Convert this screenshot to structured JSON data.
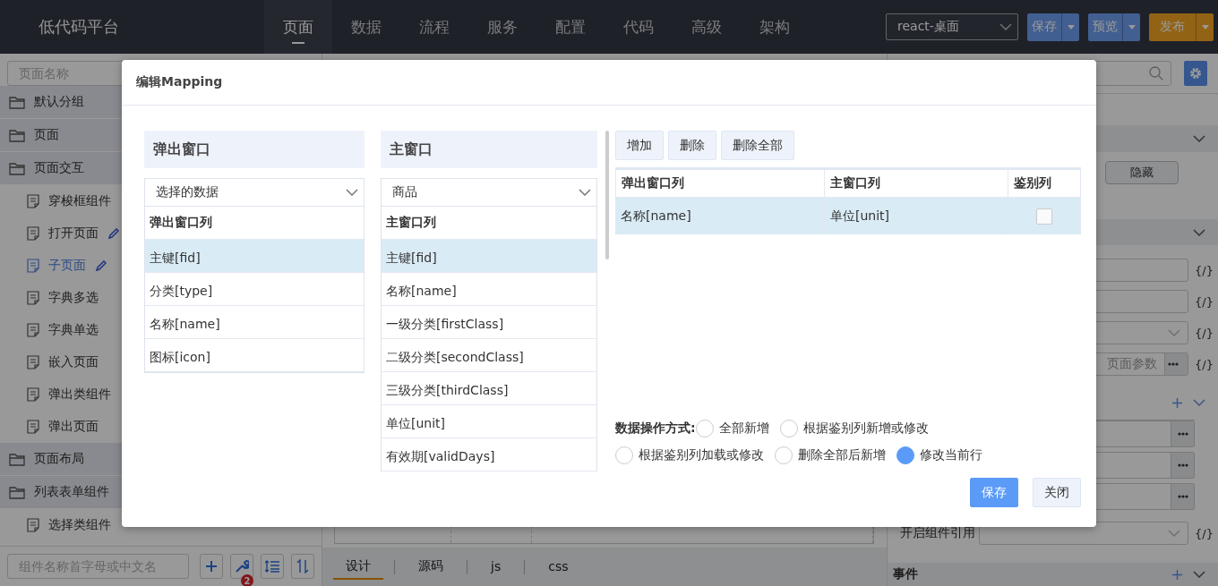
{
  "top_bar": {
    "logo": "低代码平台",
    "nav": [
      {
        "label": "页面",
        "selected": true
      },
      {
        "label": "数据",
        "selected": false
      },
      {
        "label": "流程",
        "selected": false
      },
      {
        "label": "服务",
        "selected": false
      },
      {
        "label": "配置",
        "selected": false
      },
      {
        "label": "代码",
        "selected": false
      },
      {
        "label": "高级",
        "selected": false
      },
      {
        "label": "架构",
        "selected": false
      }
    ],
    "project_select": {
      "value": "react-桌面"
    },
    "buttons": [
      {
        "label": "保存",
        "kind": "primary"
      },
      {
        "label": "预览",
        "kind": "primary"
      },
      {
        "label": "发布",
        "kind": "warning"
      }
    ]
  },
  "sidebar": {
    "search": {
      "placeholder": "页面名称"
    },
    "tree": [
      {
        "label": "默认分组",
        "kind": "folder"
      },
      {
        "label": "页面",
        "kind": "folder"
      },
      {
        "label": "页面交互",
        "kind": "folder",
        "children": [
          {
            "label": "穿梭框组件",
            "kind": "page",
            "selected": false,
            "editable": false
          },
          {
            "label": "打开页面",
            "kind": "page",
            "selected": false,
            "editable": true
          },
          {
            "label": "子页面",
            "kind": "page",
            "selected": true,
            "editable": true
          },
          {
            "label": "字典多选",
            "kind": "page",
            "selected": false,
            "editable": false
          },
          {
            "label": "字典单选",
            "kind": "page",
            "selected": false,
            "editable": false
          },
          {
            "label": "嵌入页面",
            "kind": "page",
            "selected": false,
            "editable": false
          },
          {
            "label": "弹出类组件",
            "kind": "page",
            "selected": false,
            "editable": false
          },
          {
            "label": "弹出页面",
            "kind": "page",
            "selected": false,
            "editable": false
          }
        ]
      },
      {
        "label": "页面布局",
        "kind": "folder"
      },
      {
        "label": "列表表单组件",
        "kind": "folder",
        "children": [
          {
            "label": "选择类组件",
            "kind": "page",
            "selected": false,
            "editable": false
          }
        ]
      }
    ],
    "component_search": {
      "placeholder": "组件名称首字母或中文名"
    },
    "tools": [
      {
        "kind": "add"
      },
      {
        "kind": "wrench",
        "badge": "2"
      },
      {
        "kind": "indent"
      },
      {
        "kind": "sort"
      }
    ]
  },
  "editor": {
    "tabs": [
      {
        "label": "设计",
        "selected": true
      },
      {
        "label": "源码",
        "selected": false
      },
      {
        "label": "js",
        "selected": false
      },
      {
        "label": "css",
        "selected": false
      }
    ]
  },
  "properties": {
    "hide_button": "隐藏",
    "fields": [
      {
        "kind": "input",
        "code": "{/}"
      },
      {
        "kind": "input",
        "code": "{/}"
      },
      {
        "kind": "select",
        "code": "{/}"
      },
      {
        "kind": "picker",
        "value": "页面参数",
        "code": "{/}"
      }
    ],
    "list_rows": [
      {
        "kind": "picker"
      },
      {
        "kind": "picker"
      },
      {
        "kind": "picker"
      }
    ],
    "reference": {
      "label": "开启组件引用",
      "code": "{/}"
    },
    "events_header": "事件"
  },
  "dialog": {
    "title": "编辑Mapping",
    "source": {
      "heading": "弹出窗口",
      "select": "选择的数据",
      "column_header": "弹出窗口列",
      "columns": [
        {
          "label": "主键[fid]",
          "selected": true
        },
        {
          "label": "分类[type]",
          "selected": false
        },
        {
          "label": "名称[name]",
          "selected": false
        },
        {
          "label": "图标[icon]",
          "selected": false
        }
      ]
    },
    "target": {
      "heading": "主窗口",
      "select": "商品",
      "column_header": "主窗口列",
      "columns": [
        {
          "label": "主键[fid]",
          "selected": true
        },
        {
          "label": "名称[name]",
          "selected": false
        },
        {
          "label": "一级分类[firstClass]",
          "selected": false
        },
        {
          "label": "二级分类[secondClass]",
          "selected": false
        },
        {
          "label": "三级分类[thirdClass]",
          "selected": false
        },
        {
          "label": "单位[unit]",
          "selected": false
        },
        {
          "label": "有效期[validDays]",
          "selected": false
        }
      ]
    },
    "toolbar": [
      "增加",
      "删除",
      "删除全部"
    ],
    "mapping_table": {
      "columns": [
        "弹出窗口列",
        "主窗口列",
        "鉴别列"
      ],
      "rows": [
        {
          "source": "名称[name]",
          "target": "单位[unit]",
          "key": false,
          "selected": true
        }
      ]
    },
    "operation": {
      "label": "数据操作方式:",
      "options": [
        {
          "label": "全部新增",
          "selected": false
        },
        {
          "label": "根据鉴别列新增或修改",
          "selected": false
        },
        {
          "label": "根据鉴别列加载或修改",
          "selected": false
        },
        {
          "label": "删除全部后新增",
          "selected": false
        },
        {
          "label": "修改当前行",
          "selected": true
        }
      ]
    },
    "buttons": [
      {
        "label": "保存",
        "kind": "primary"
      },
      {
        "label": "关闭",
        "kind": "default"
      }
    ]
  }
}
